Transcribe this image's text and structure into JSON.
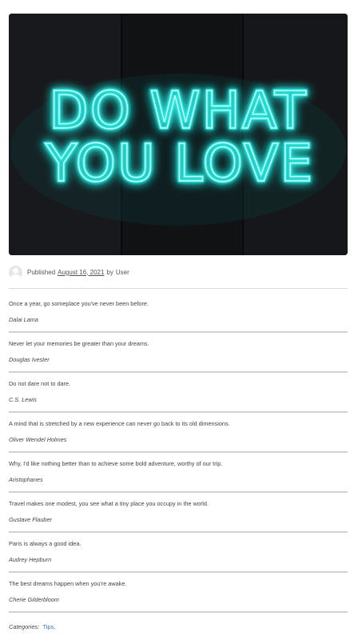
{
  "hero": {
    "sign_line_1": "DO WHAT",
    "sign_line_2": "YOU LOVE",
    "neon_color": "#2ee8e0"
  },
  "post_meta": {
    "published_label": "Published",
    "date": "August 16, 2021",
    "by_label": "by",
    "author": "User"
  },
  "quotes": [
    {
      "text": "Once a year, go someplace you've never been before.",
      "author": "Dalai Lama"
    },
    {
      "text": "Never let your memories be greater than your dreams.",
      "author": "Douglas Ivester"
    },
    {
      "text": "Do not dare not to dare.",
      "author": "C.S. Lewis"
    },
    {
      "text": "A mind that is stretched by a new experience can never go back to its old dimensions.",
      "author": "Oliver Wendel Holmes"
    },
    {
      "text": "Why, I'd like nothing better than to achieve some bold adventure, worthy of our trip.",
      "author": "Aristophanes"
    },
    {
      "text": "Travel makes one modest, you see what a tiny place you occupy in the world.",
      "author": "Gustave Flauber"
    },
    {
      "text": "Paris is always a good idea.",
      "author": "Audrey Hepburn"
    },
    {
      "text": "The best dreams happen when you're awake.",
      "author": "Cherie Gilderbloom"
    }
  ],
  "footer": {
    "categories_label": "Categories:",
    "category": "Tips",
    "category_sep": ","
  }
}
